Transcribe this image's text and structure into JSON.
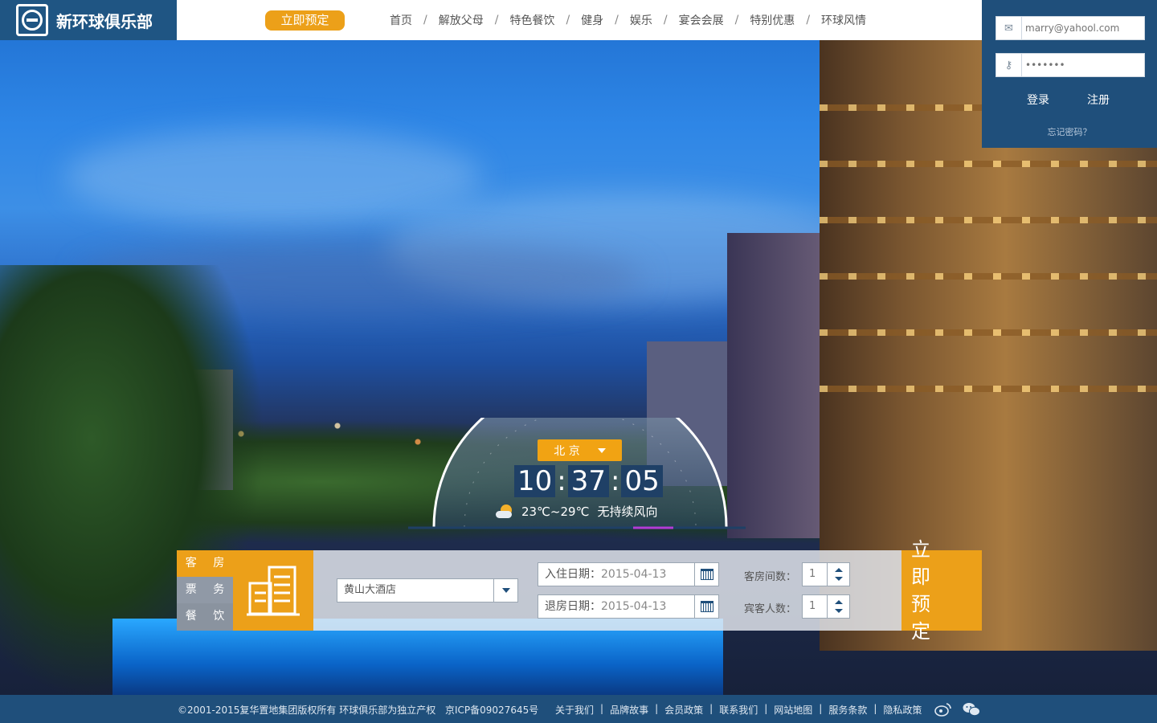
{
  "logo": {
    "text": "新环球俱乐部"
  },
  "header": {
    "book_now": "立即预定",
    "nav": [
      "首页",
      "解放父母",
      "特色餐饮",
      "健身",
      "娱乐",
      "宴会会展",
      "特别优惠",
      "环球风情"
    ],
    "separator": "/"
  },
  "login": {
    "email_placeholder": "marry@yahool.com",
    "password_placeholder": "•••••••",
    "login_label": "登录",
    "register_label": "注册",
    "forgot_label": "忘记密码？"
  },
  "widget": {
    "city": "北 京",
    "time": {
      "h": "10",
      "m": "37",
      "s": "05"
    },
    "temperature": "23℃~29℃",
    "wind": "无持续风向"
  },
  "booking": {
    "tabs": [
      "客 房",
      "票 务",
      "餐 饮"
    ],
    "hotel": "黄山大酒店",
    "checkin_label": "入住日期：",
    "checkin_value": "2015-04-13",
    "checkout_label": "退房日期：",
    "checkout_value": "2015-04-13",
    "rooms_label": "客房间数：",
    "rooms_value": "1",
    "guests_label": "宾客人数：",
    "guests_value": "1",
    "submit_line1": "立 即",
    "submit_line2": "预 定"
  },
  "footer": {
    "copyright": "©2001-2015复华置地集团版权所有 环球俱乐部为独立产权",
    "icp": "京ICP备09027645号",
    "links": [
      "关于我们",
      "品牌故事",
      "会员政策",
      "联系我们",
      "网站地图",
      "服务条款",
      "隐私政策"
    ],
    "separator": "|"
  },
  "colors": {
    "accent": "#eca019",
    "navy": "#1f4f7b"
  }
}
